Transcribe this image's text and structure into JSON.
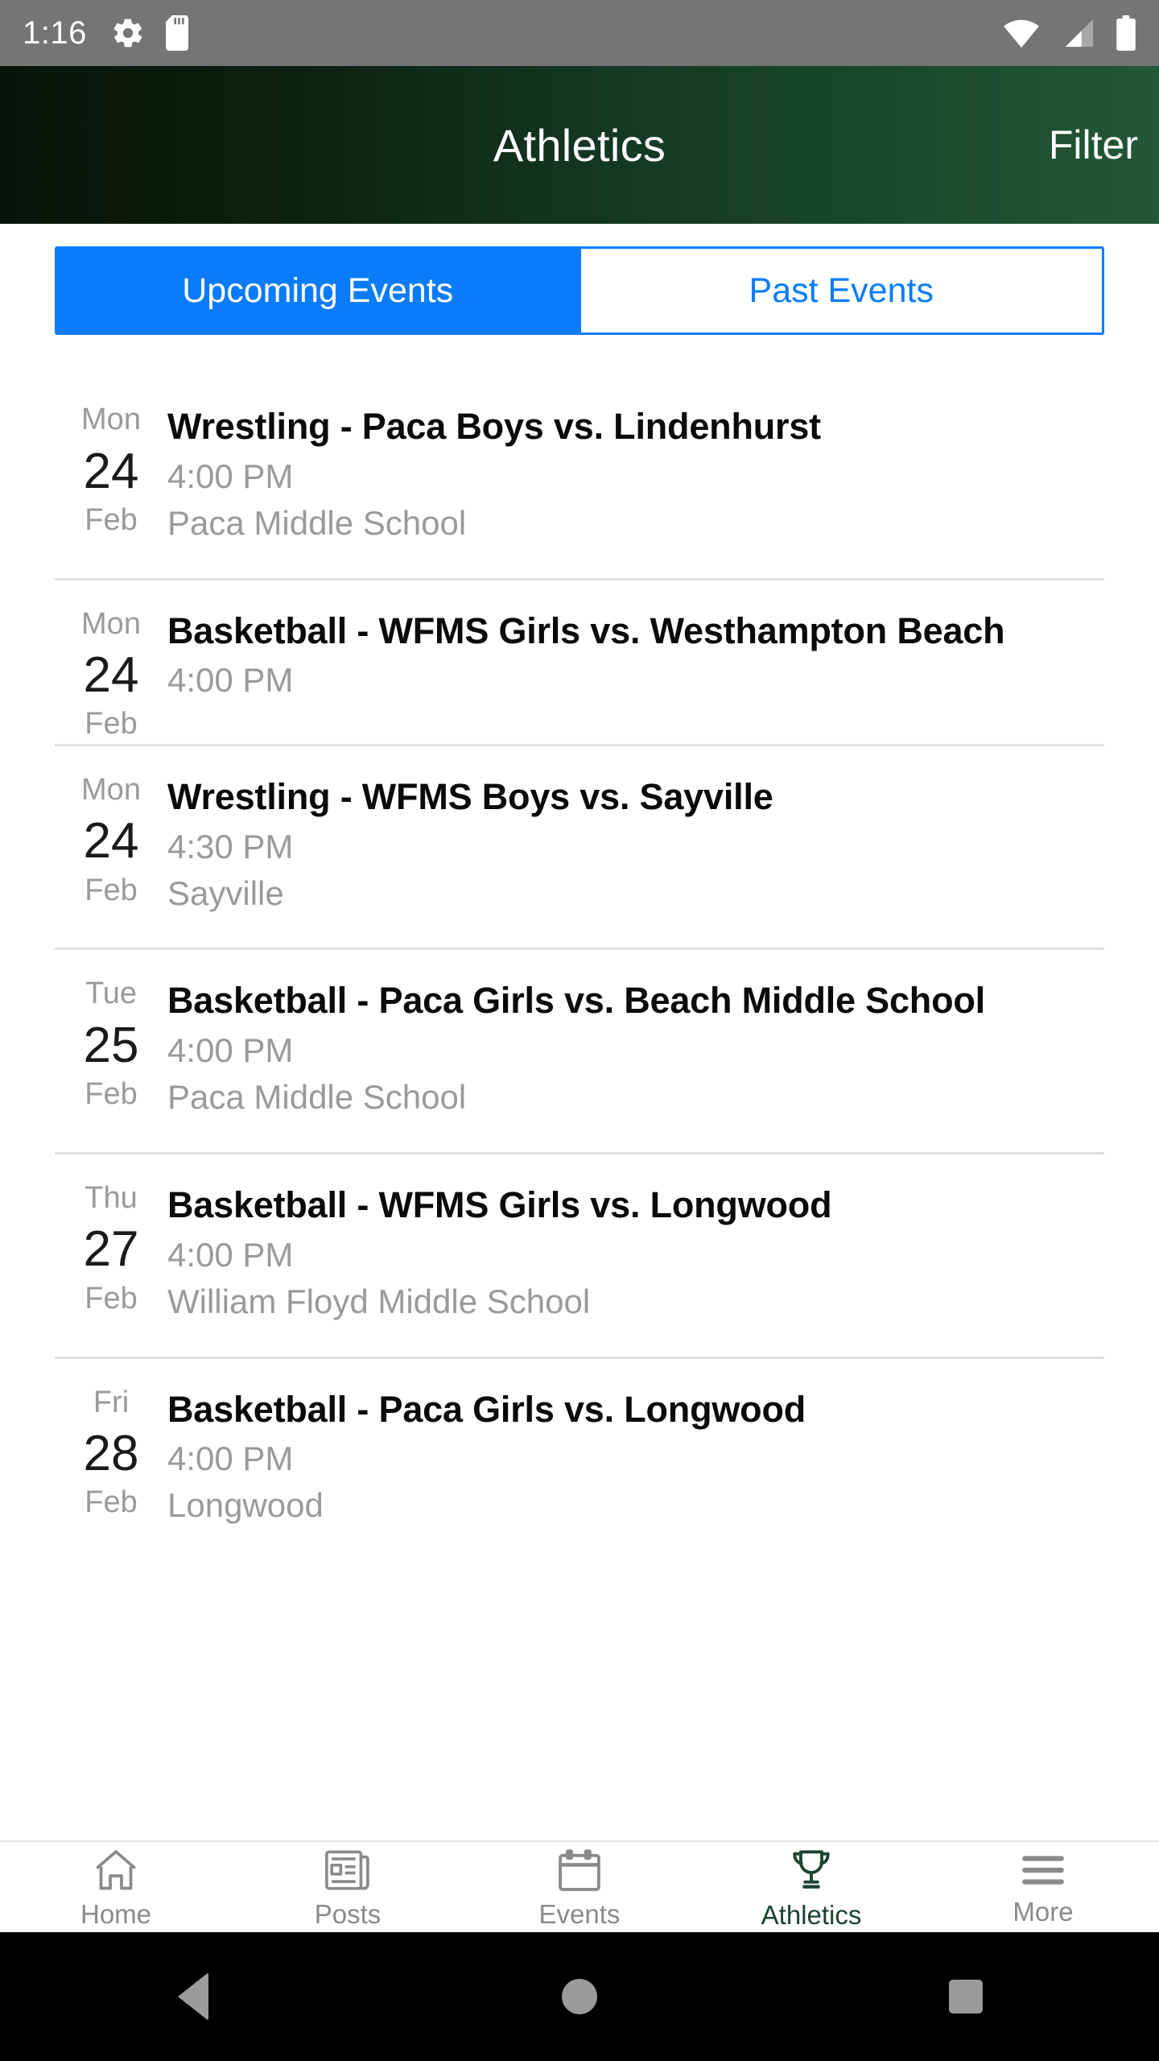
{
  "status_bar": {
    "time": "1:16",
    "left_icons": [
      "gear-icon",
      "sd-card-icon"
    ],
    "right_icons": [
      "wifi-icon",
      "cellular-signal-icon",
      "battery-icon"
    ]
  },
  "header": {
    "title": "Athletics",
    "action_label": "Filter",
    "gradient_start": "#081409",
    "gradient_end": "#225737"
  },
  "tabs": {
    "accent_color": "#0a7cfa",
    "items": [
      {
        "label": "Upcoming Events",
        "active": true
      },
      {
        "label": "Past Events",
        "active": false
      }
    ]
  },
  "events": [
    {
      "dow": "Mon",
      "day": "24",
      "month": "Feb",
      "title": "Wrestling - Paca Boys vs. Lindenhurst",
      "time": "4:00 PM",
      "location": "Paca Middle School"
    },
    {
      "dow": "Mon",
      "day": "24",
      "month": "Feb",
      "title": "Basketball - WFMS Girls vs. Westhampton Beach",
      "time": "4:00 PM",
      "location": ""
    },
    {
      "dow": "Mon",
      "day": "24",
      "month": "Feb",
      "title": "Wrestling - WFMS Boys vs. Sayville",
      "time": "4:30 PM",
      "location": "Sayville"
    },
    {
      "dow": "Tue",
      "day": "25",
      "month": "Feb",
      "title": "Basketball - Paca Girls vs. Beach Middle School",
      "time": "4:00 PM",
      "location": "Paca Middle School"
    },
    {
      "dow": "Thu",
      "day": "27",
      "month": "Feb",
      "title": "Basketball - WFMS Girls vs. Longwood",
      "time": "4:00 PM",
      "location": "William Floyd Middle School"
    },
    {
      "dow": "Fri",
      "day": "28",
      "month": "Feb",
      "title": "Basketball - Paca Girls vs. Longwood",
      "time": "4:00 PM",
      "location": "Longwood"
    }
  ],
  "bottom_nav": {
    "active_color": "#1d4430",
    "inactive_color": "#8a8a8a",
    "items": [
      {
        "label": "Home",
        "icon": "home-icon",
        "active": false
      },
      {
        "label": "Posts",
        "icon": "newspaper-icon",
        "active": false
      },
      {
        "label": "Events",
        "icon": "calendar-icon",
        "active": false
      },
      {
        "label": "Athletics",
        "icon": "trophy-icon",
        "active": true
      },
      {
        "label": "More",
        "icon": "hamburger-icon",
        "active": false
      }
    ]
  },
  "system_nav": {
    "back": "back-triangle-icon",
    "home": "home-circle-icon",
    "recents": "recents-square-icon"
  }
}
